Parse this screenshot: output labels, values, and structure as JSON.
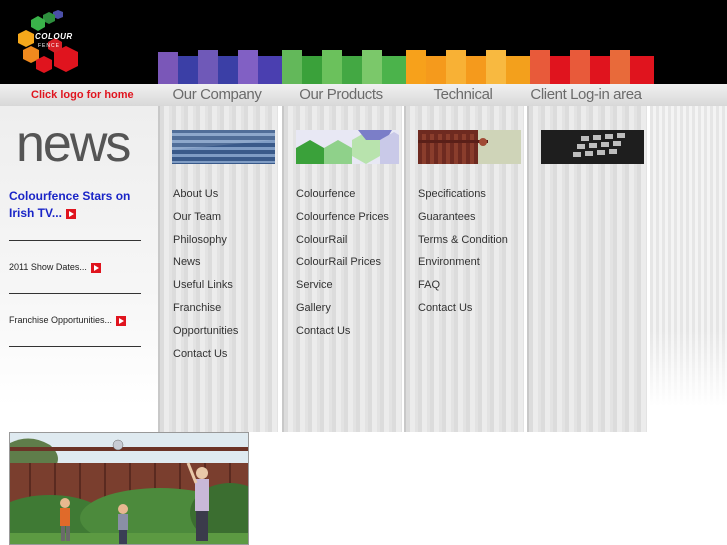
{
  "header": {
    "logo_text": "COLOUR",
    "logo_subtext": "FENCE",
    "home_link": "Click logo for home"
  },
  "menu": {
    "tabs": [
      {
        "label": "Our Company",
        "color": "#3b3fa6"
      },
      {
        "label": "Our Products",
        "color": "#3ba13b"
      },
      {
        "label": "Technical",
        "color": "#f29a1d"
      },
      {
        "label": "Client Log-in area",
        "color": "#d61e25"
      }
    ]
  },
  "news": {
    "heading": "news",
    "items": [
      {
        "text": "Colourfence Stars on Irish TV..."
      },
      {
        "text": "2011 Show Dates..."
      },
      {
        "text": "Franchise Opportunities..."
      }
    ]
  },
  "columns": {
    "company": [
      "About Us",
      "Our Team",
      "Philosophy",
      "News",
      "Useful Links",
      "Franchise",
      "Opportunities",
      "Contact Us"
    ],
    "products": [
      "Colourfence",
      "Colourfence Prices",
      "ColourRail",
      "ColourRail Prices",
      "Service",
      "Gallery",
      "Contact Us"
    ],
    "technical": [
      "Specifications",
      "Guarantees",
      "Terms & Condition",
      "Environment",
      "FAQ",
      "Contact Us"
    ]
  },
  "colors": {
    "accent_red": "#e0141e",
    "news_link_blue": "#1a25c7"
  }
}
